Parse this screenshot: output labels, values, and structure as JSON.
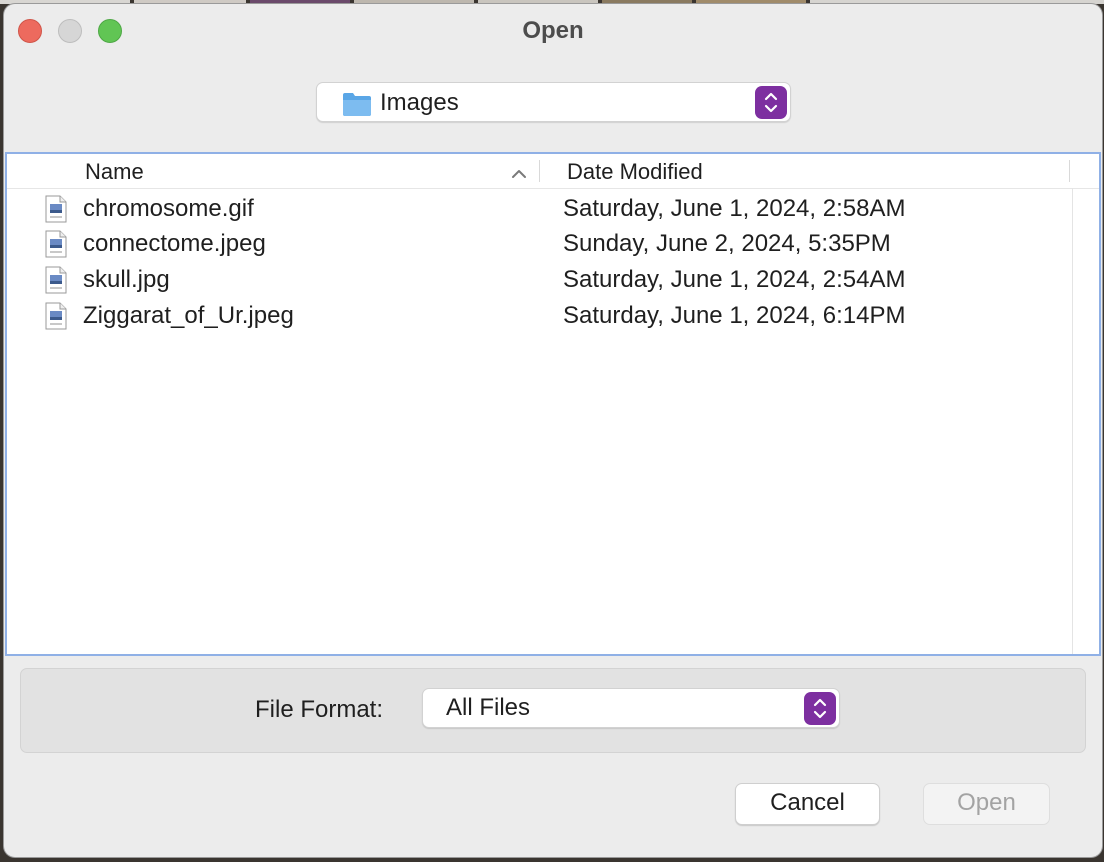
{
  "window": {
    "title": "Open"
  },
  "location": {
    "label": "Images",
    "icon": "folder-icon",
    "accent_color": "#7d2fa0"
  },
  "filelist": {
    "columns": {
      "name": "Name",
      "date": "Date Modified",
      "sort": "ascending"
    },
    "files": [
      {
        "name": "chromosome.gif",
        "date": "Saturday, June 1, 2024, 2:58AM"
      },
      {
        "name": "connectome.jpeg",
        "date": "Sunday, June 2, 2024, 5:35PM"
      },
      {
        "name": "skull.jpg",
        "date": "Saturday, June 1, 2024, 2:54AM"
      },
      {
        "name": "Ziggarat_of_Ur.jpeg",
        "date": "Saturday, June 1, 2024, 6:14PM"
      }
    ]
  },
  "format": {
    "label": "File Format:",
    "value": "All Files"
  },
  "buttons": {
    "cancel": "Cancel",
    "open": "Open"
  }
}
